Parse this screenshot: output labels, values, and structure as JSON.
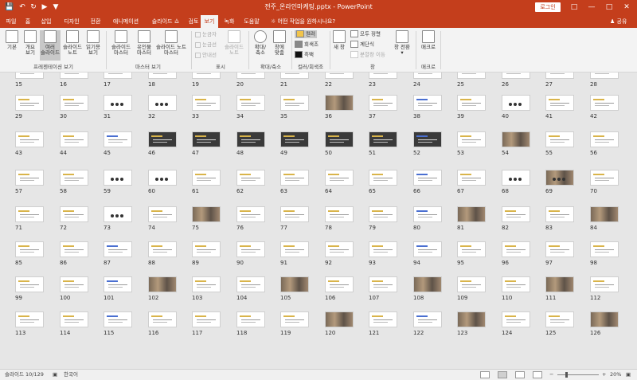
{
  "window": {
    "title": "전주_온라인마케팅.pptx  -  PowerPoint",
    "login_label": "로그인",
    "quick_access": [
      "save-icon",
      "undo-icon",
      "redo-icon",
      "start-from-beginning-icon",
      "customize-icon"
    ],
    "controls": [
      "ribbon-display-options-icon",
      "minimize-icon",
      "maximize-icon",
      "close-icon"
    ]
  },
  "tabs": [
    {
      "label": "파일",
      "active": false
    },
    {
      "label": "홈",
      "active": false
    },
    {
      "label": "삽입",
      "active": false
    },
    {
      "label": "디자인",
      "active": false
    },
    {
      "label": "전환",
      "active": false
    },
    {
      "label": "애니메이션",
      "active": false
    },
    {
      "label": "슬라이드 쇼",
      "active": false
    },
    {
      "label": "검토",
      "active": false
    },
    {
      "label": "보기",
      "active": true
    },
    {
      "label": "녹화",
      "active": false
    },
    {
      "label": "도움말",
      "active": false
    }
  ],
  "tell_me": "어떤 작업을 원하시나요?",
  "share": "공유",
  "ribbon": {
    "presentation_views": {
      "label": "프레젠테이션 보기",
      "buttons": [
        {
          "line1": "기본",
          "line2": "",
          "active": false
        },
        {
          "line1": "개요",
          "line2": "보기",
          "active": false
        },
        {
          "line1": "여러",
          "line2": "슬라이드",
          "active": true
        },
        {
          "line1": "슬라이드",
          "line2": "노트",
          "active": false
        },
        {
          "line1": "읽기용",
          "line2": "보기",
          "active": false
        }
      ]
    },
    "master_views": {
      "label": "마스터 보기",
      "buttons": [
        {
          "line1": "슬라이드",
          "line2": "마스터"
        },
        {
          "line1": "유인물",
          "line2": "마스터"
        },
        {
          "line1": "슬라이드 노트",
          "line2": "마스터"
        }
      ]
    },
    "show": {
      "label": "표시",
      "checks": [
        "눈금자",
        "눈금선",
        "안내선"
      ],
      "notes": {
        "line1": "슬라이드",
        "line2": "노트"
      }
    },
    "zoom": {
      "label": "확대/축소",
      "buttons": [
        {
          "line1": "확대/",
          "line2": "축소"
        },
        {
          "line1": "창에",
          "line2": "맞춤"
        }
      ]
    },
    "color": {
      "label": "컬러/회색조",
      "options": [
        {
          "label": "컬러",
          "color": "#f2c44a"
        },
        {
          "label": "회색조",
          "color": "#888888"
        },
        {
          "label": "흑백",
          "color": "#111111"
        }
      ]
    },
    "window": {
      "label": "창",
      "new_window": "새 창",
      "items": [
        {
          "label": "모두 정렬",
          "disabled": false
        },
        {
          "label": "계단식",
          "disabled": false
        },
        {
          "label": "분할창 이동",
          "disabled": true
        }
      ],
      "switch": {
        "line1": "창 전환",
        "line2": ""
      }
    },
    "macros": {
      "label": "매크로",
      "button": "매크로"
    }
  },
  "slides": {
    "selected": 10,
    "numbers": [
      15,
      16,
      17,
      18,
      19,
      20,
      21,
      22,
      23,
      24,
      25,
      26,
      27,
      28,
      29,
      30,
      31,
      32,
      33,
      34,
      35,
      36,
      37,
      38,
      39,
      40,
      41,
      42,
      43,
      44,
      45,
      46,
      47,
      48,
      49,
      50,
      51,
      52,
      53,
      54,
      55,
      56,
      57,
      58,
      59,
      60,
      61,
      62,
      63,
      64,
      65,
      66,
      67,
      68,
      69,
      70,
      71,
      72,
      73,
      74,
      75,
      76,
      77,
      78,
      79,
      80,
      81,
      82,
      83,
      84,
      85,
      86,
      87,
      88,
      89,
      90,
      91,
      92,
      93,
      94,
      95,
      96,
      97,
      98,
      99,
      100,
      101,
      102,
      103,
      104,
      105,
      106,
      107,
      108,
      109,
      110,
      111,
      112,
      113,
      114,
      115,
      116,
      117,
      118,
      119,
      120,
      121,
      122,
      123,
      124,
      125,
      126
    ]
  },
  "status": {
    "slide_info": "슬라이드 10/129",
    "language": "한국어",
    "zoom": "20%"
  }
}
